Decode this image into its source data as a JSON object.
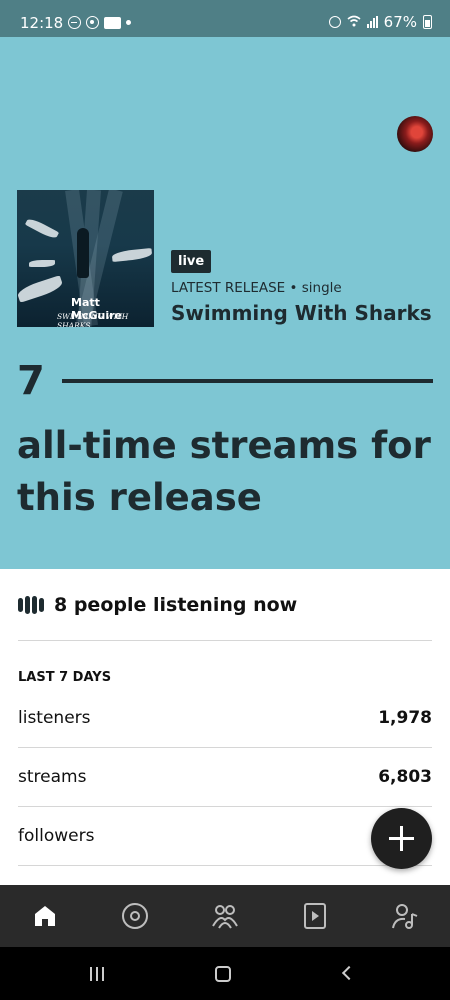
{
  "status_bar": {
    "time": "12:18",
    "battery": "67%"
  },
  "release": {
    "badge": "live",
    "label": "LATEST RELEASE • single",
    "title": "Swimming With Sharks",
    "cover_artist": "Matt McGuire",
    "cover_title": "SWIMMING WITH SHARKS"
  },
  "streams": {
    "count": "7",
    "description": "all-time streams for this release"
  },
  "listening_now": "8 people listening now",
  "last7": {
    "title": "LAST 7 DAYS",
    "rows": [
      {
        "label": "listeners",
        "value": "1,978"
      },
      {
        "label": "streams",
        "value": "6,803"
      },
      {
        "label": "followers",
        "value": ""
      }
    ]
  },
  "nav": {
    "items": [
      {
        "icon": "home-icon",
        "active": true
      },
      {
        "icon": "music-icon",
        "active": false
      },
      {
        "icon": "audience-icon",
        "active": false
      },
      {
        "icon": "play-icon",
        "active": false
      },
      {
        "icon": "profile-icon",
        "active": false
      }
    ]
  },
  "colors": {
    "hero": "#7ec6d3",
    "status_bar": "#4f7f86",
    "dark": "#1e2b30",
    "nav_bg": "#2a2a2a"
  }
}
